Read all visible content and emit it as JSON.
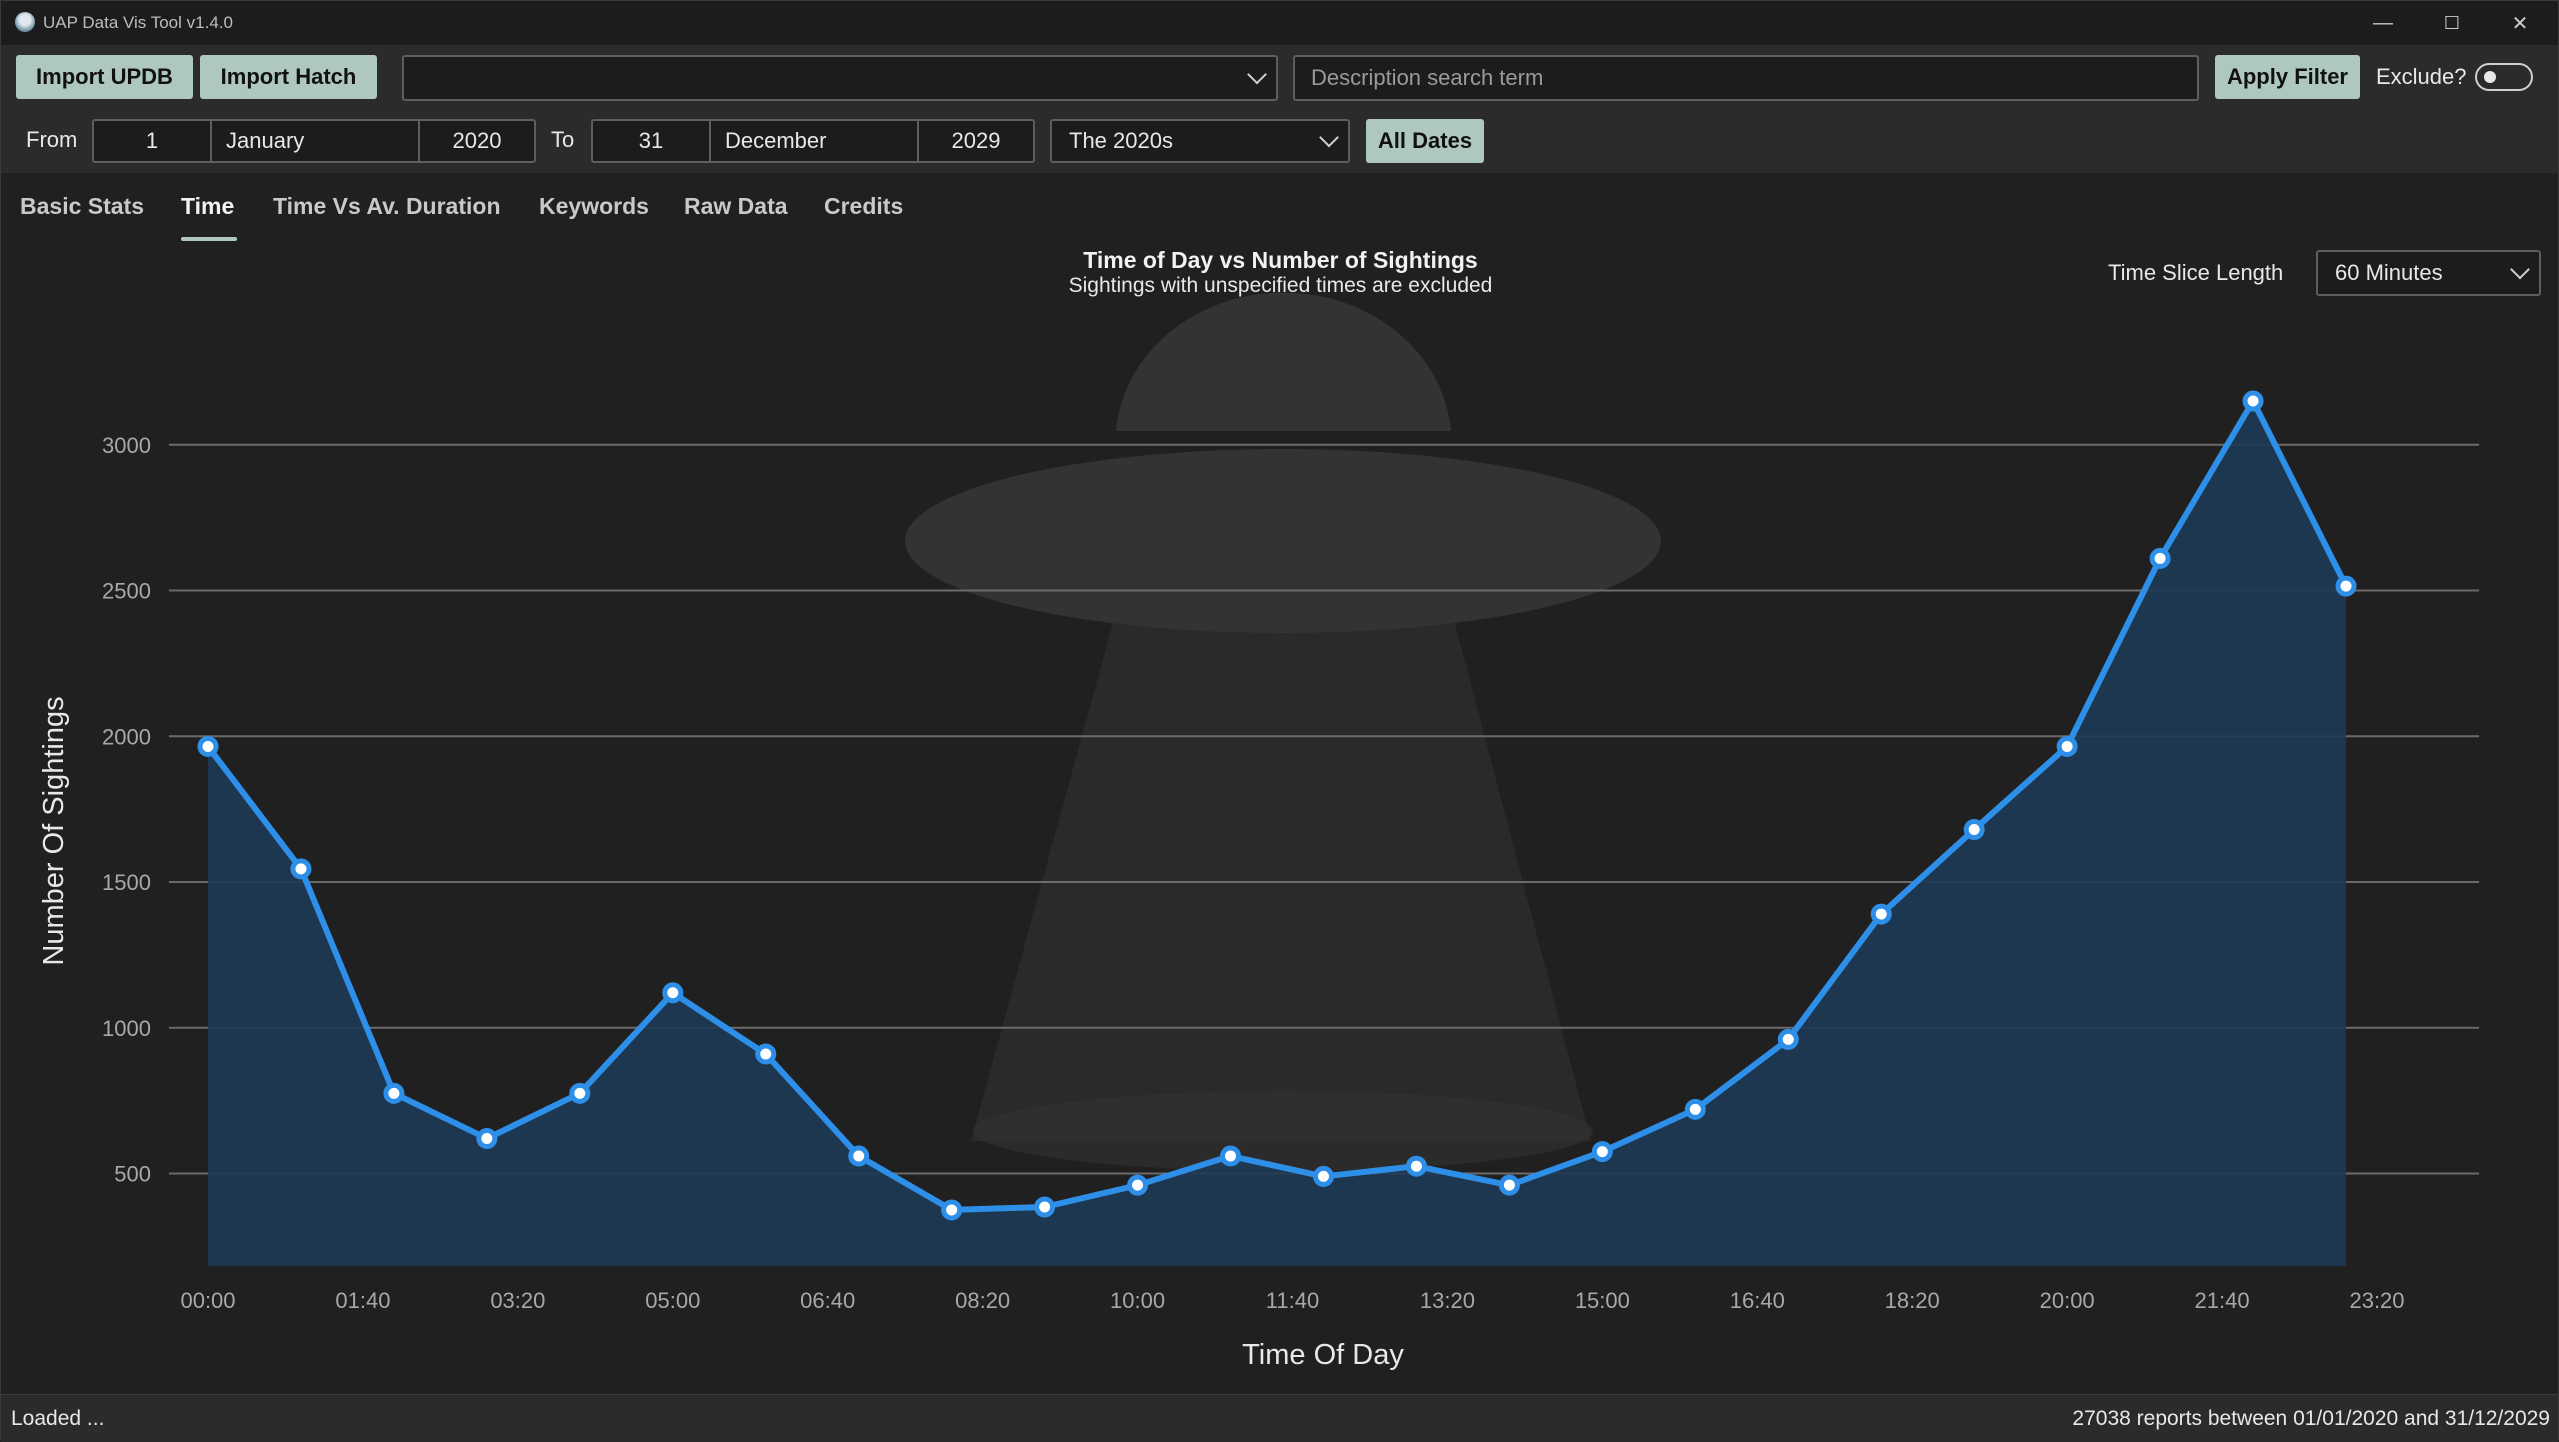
{
  "window": {
    "title": "UAP Data Vis Tool v1.4.0",
    "minimize": "—",
    "maximize": "☐",
    "close": "✕"
  },
  "toolbar": {
    "import_updb": "Import UPDB",
    "import_hatch": "Import Hatch",
    "combo_value": "",
    "search_placeholder": "Description search term",
    "apply_filter": "Apply Filter",
    "exclude_label": "Exclude?",
    "exclude_on": false,
    "from_label": "From",
    "from": {
      "day": "1",
      "month": "January",
      "year": "2020"
    },
    "to_label": "To",
    "to": {
      "day": "31",
      "month": "December",
      "year": "2029"
    },
    "decade": "The 2020s",
    "all_dates": "All Dates"
  },
  "tabs": [
    {
      "label": "Basic Stats",
      "active": false
    },
    {
      "label": "Time",
      "active": true
    },
    {
      "label": "Time Vs Av. Duration",
      "active": false
    },
    {
      "label": "Keywords",
      "active": false
    },
    {
      "label": "Raw Data",
      "active": false
    },
    {
      "label": "Credits",
      "active": false
    }
  ],
  "time_slice": {
    "label": "Time Slice Length",
    "value": "60 Minutes"
  },
  "chart_data": {
    "type": "area",
    "title": "Time of Day vs Number of Sightings",
    "subtitle": "Sightings with unspecified times are excluded",
    "xlabel": "Time Of Day",
    "ylabel": "Number Of Sightings",
    "x": [
      "00:00",
      "01:00",
      "02:00",
      "03:00",
      "04:00",
      "05:00",
      "06:00",
      "07:00",
      "08:00",
      "09:00",
      "10:00",
      "11:00",
      "12:00",
      "13:00",
      "14:00",
      "15:00",
      "16:00",
      "17:00",
      "18:00",
      "19:00",
      "20:00",
      "21:00",
      "22:00",
      "23:00"
    ],
    "values": [
      1965,
      1545,
      775,
      620,
      775,
      1120,
      910,
      560,
      375,
      385,
      460,
      560,
      490,
      525,
      460,
      575,
      720,
      960,
      1390,
      1680,
      1965,
      2610,
      3150,
      2515
    ],
    "x_tick_labels": [
      "00:00",
      "01:40",
      "03:20",
      "05:00",
      "06:40",
      "08:20",
      "10:00",
      "11:40",
      "13:20",
      "15:00",
      "16:40",
      "18:20",
      "20:00",
      "21:40",
      "23:20"
    ],
    "y_ticks": [
      500,
      1000,
      1500,
      2000,
      2500,
      3000
    ],
    "ylim": [
      180,
      3300
    ],
    "xlim_minutes": [
      0,
      1400
    ],
    "grid": "horizontal",
    "line_color": "#2e8fe8",
    "fill_color": "#1e3a55"
  },
  "status": {
    "left": "Loaded ...",
    "right": "27038 reports between 01/01/2020 and 31/12/2029"
  }
}
